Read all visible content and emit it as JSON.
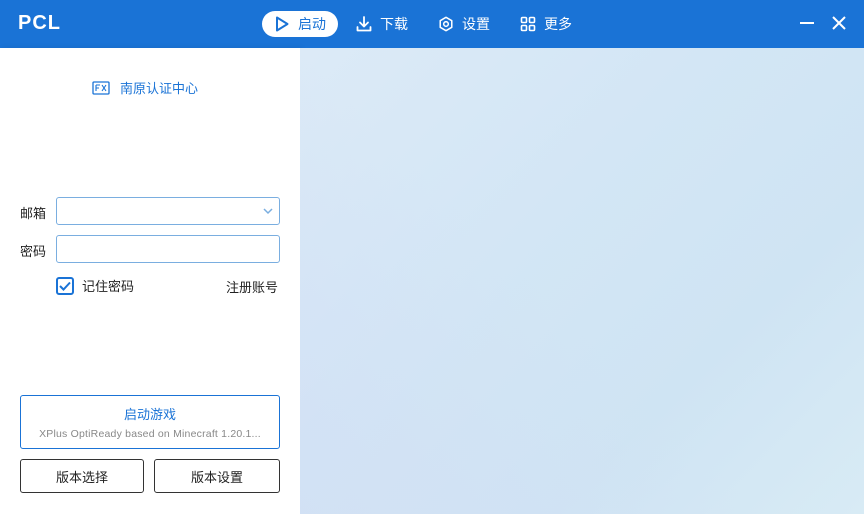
{
  "app": {
    "brand": "PCL"
  },
  "nav": {
    "items": [
      {
        "label": "启动",
        "icon": "play-icon",
        "active": true
      },
      {
        "label": "下载",
        "icon": "download-icon",
        "active": false
      },
      {
        "label": "设置",
        "icon": "gear-icon",
        "active": false
      },
      {
        "label": "更多",
        "icon": "grid-icon",
        "active": false
      }
    ]
  },
  "login": {
    "auth_title": "南原认证中心",
    "email_label": "邮箱",
    "email_value": "",
    "password_label": "密码",
    "password_value": "",
    "remember_label": "记住密码",
    "remember_checked": true,
    "register_label": "注册账号"
  },
  "launch": {
    "title": "启动游戏",
    "subtitle": "XPlus OptiReady based on Minecraft 1.20.1..."
  },
  "buttons": {
    "version_select": "版本选择",
    "version_settings": "版本设置"
  },
  "colors": {
    "accent": "#1a73d6",
    "titlebar": "#1a73d6",
    "background": "#d3e6f5"
  }
}
